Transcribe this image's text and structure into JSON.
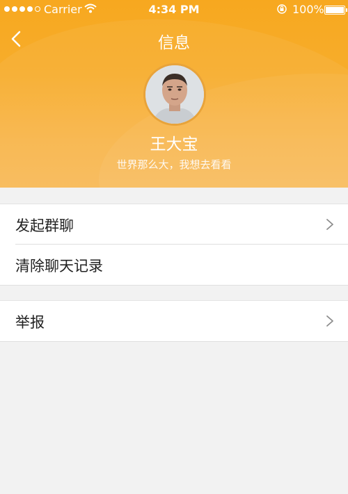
{
  "status_bar": {
    "carrier": "Carrier",
    "time": "4:34 PM",
    "battery": "100%"
  },
  "nav": {
    "title": "信息",
    "back_icon": "chevron-left-icon"
  },
  "profile": {
    "name": "王大宝",
    "signature": "世界那么大，我想去看看"
  },
  "menu": {
    "start_group_chat": "发起群聊",
    "clear_chat_history": "清除聊天记录",
    "report": "举报"
  },
  "colors": {
    "header_orange": "#f7a81f",
    "background": "#f2f2f2",
    "text": "#222222"
  }
}
